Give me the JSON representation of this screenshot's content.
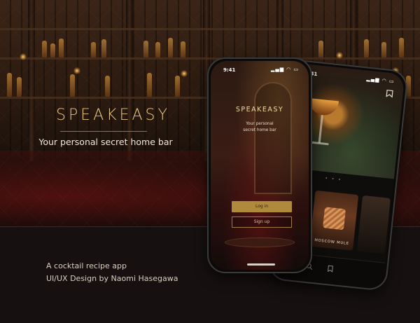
{
  "brand": {
    "name": "SPEAKEASY",
    "tagline": "Your personal secret home bar"
  },
  "credits": {
    "line1": "A cocktail recipe app",
    "line2": "UI/UX Design by Naomi Hasegawa"
  },
  "front_phone": {
    "status": {
      "time": "9:41",
      "icons": "▂▄▆ ◠ ▭"
    },
    "brand": "SPEAKEASY",
    "tagline_line1": "Your personal",
    "tagline_line2": "secret home bar",
    "login_label": "Log in",
    "signup_label": "Sign up"
  },
  "back_phone": {
    "status": {
      "time": "9:41",
      "icons": "▂▄▆ ◠ ▭"
    },
    "bookmark_icon": "bookmark-icon",
    "carousel_dots": "• • •",
    "featured_card_title": "MOSCOW MULE",
    "nav_icons": {
      "cocktail": "🍸",
      "search": "⌕",
      "list": "▤",
      "bookmark": "⚑"
    }
  },
  "colors": {
    "accent_gold": "#e8c77a",
    "button_gold": "#b08a3c",
    "background": "#140e0b"
  }
}
